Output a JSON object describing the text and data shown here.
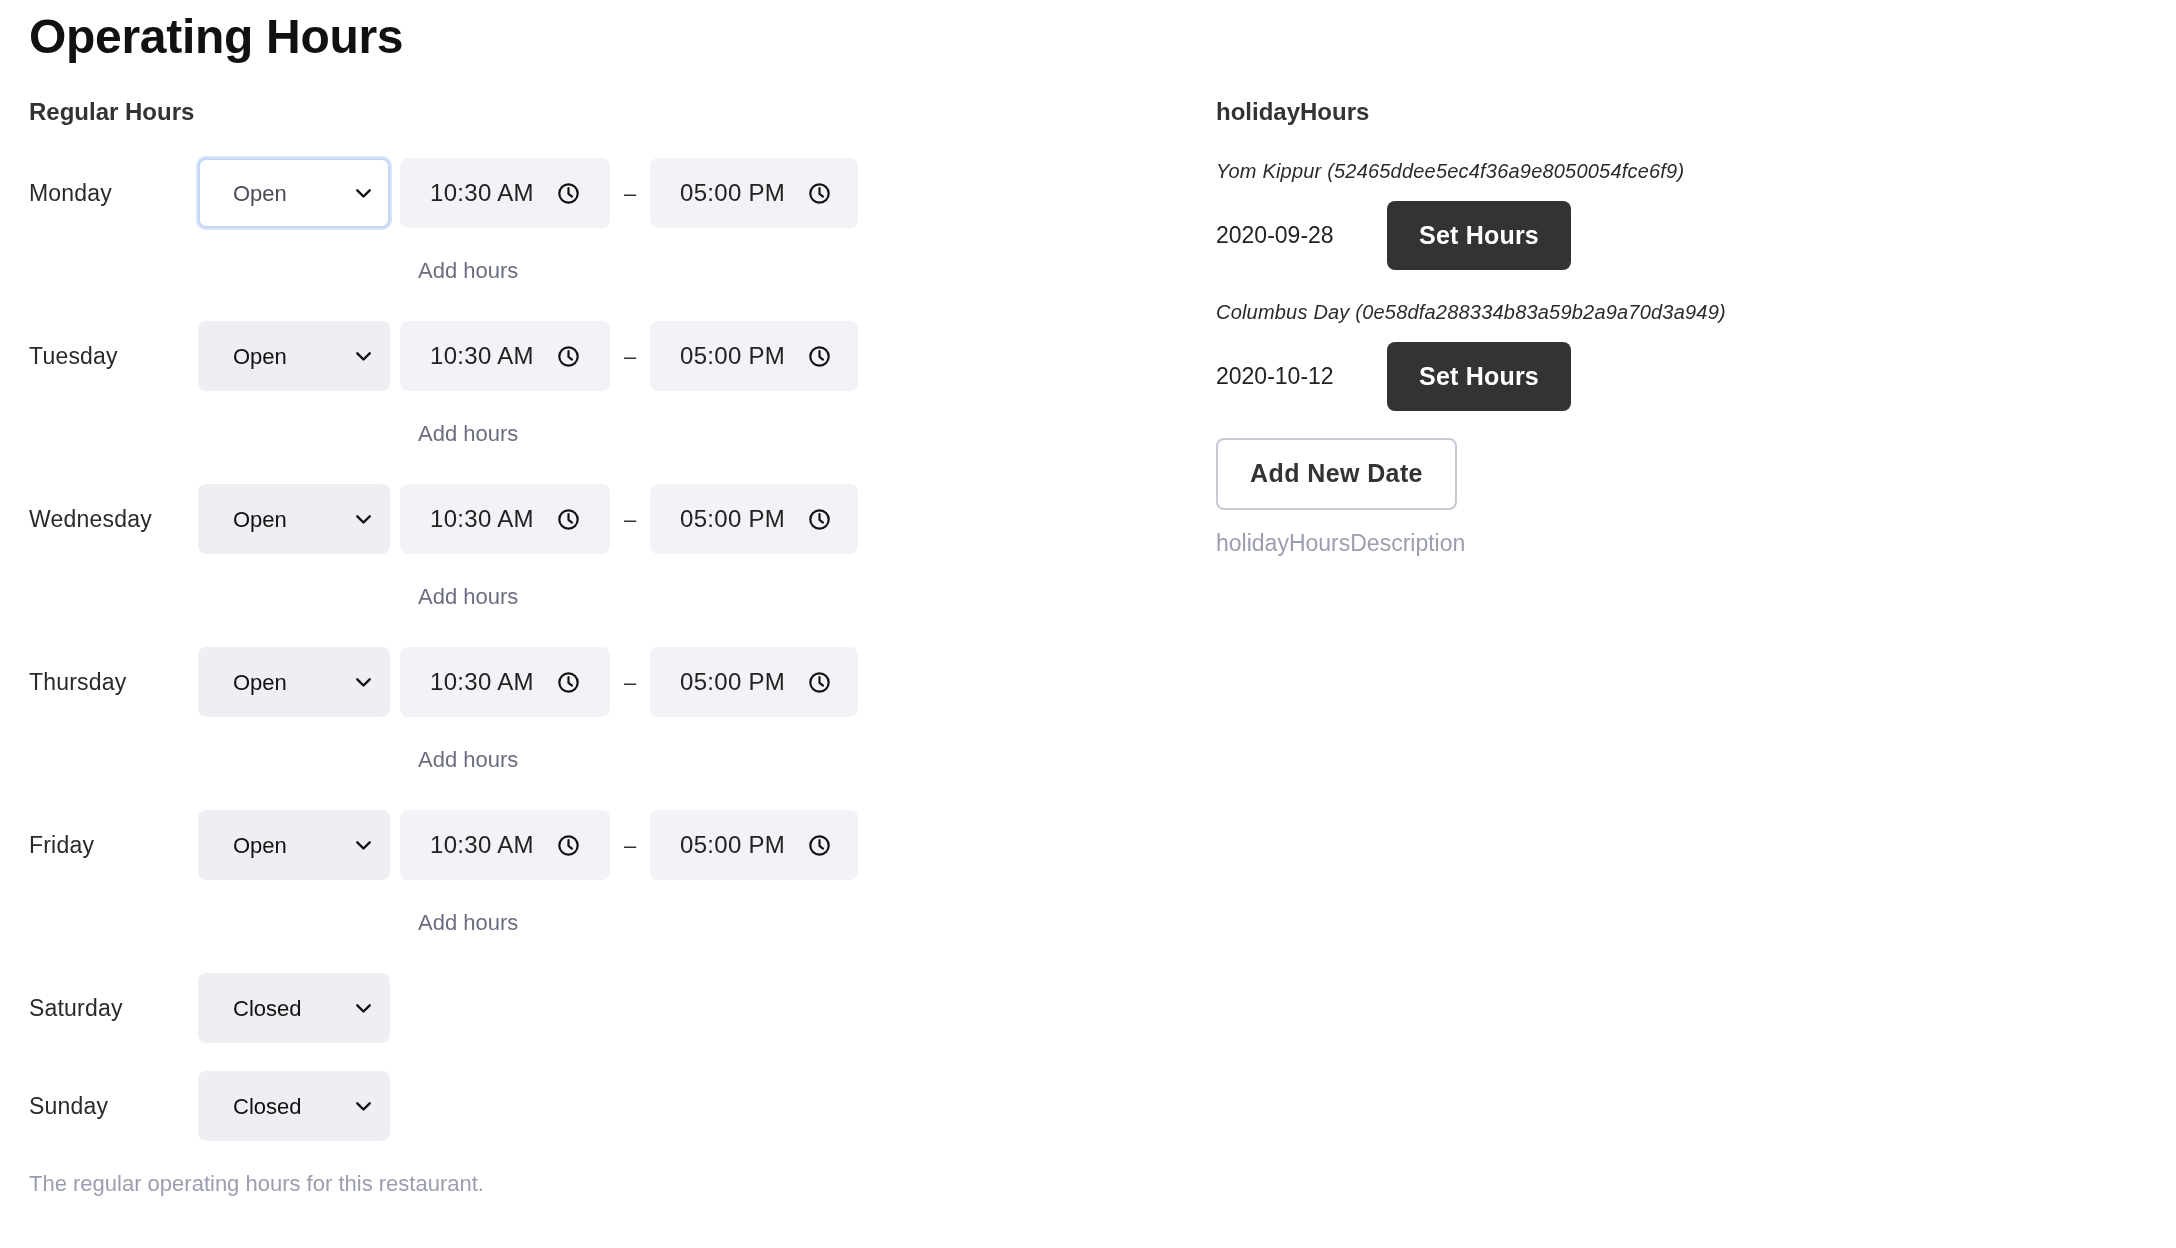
{
  "title": "Operating Hours",
  "regular_hours": {
    "heading": "Regular Hours",
    "days": [
      {
        "day": "Monday",
        "status": {
          "value": "Open",
          "focused": true
        },
        "hours": [
          {
            "start": "10:30 AM",
            "separator": "–",
            "end": "05:00 PM"
          }
        ],
        "add_hours": "Add hours"
      },
      {
        "day": "Tuesday",
        "status": {
          "value": "Open",
          "focused": false
        },
        "hours": [
          {
            "start": "10:30 AM",
            "separator": "–",
            "end": "05:00 PM"
          }
        ],
        "add_hours": "Add hours"
      },
      {
        "day": "Wednesday",
        "status": {
          "value": "Open",
          "focused": false
        },
        "hours": [
          {
            "start": "10:30 AM",
            "separator": "–",
            "end": "05:00 PM"
          }
        ],
        "add_hours": "Add hours"
      },
      {
        "day": "Thursday",
        "status": {
          "value": "Open",
          "focused": false
        },
        "hours": [
          {
            "start": "10:30 AM",
            "separator": "–",
            "end": "05:00 PM"
          }
        ],
        "add_hours": "Add hours"
      },
      {
        "day": "Friday",
        "status": {
          "value": "Open",
          "focused": false
        },
        "hours": [
          {
            "start": "10:30 AM",
            "separator": "–",
            "end": "05:00 PM"
          }
        ],
        "add_hours": "Add hours"
      },
      {
        "day": "Saturday",
        "status": {
          "value": "Closed",
          "focused": false
        }
      },
      {
        "day": "Sunday",
        "status": {
          "value": "Closed",
          "focused": false
        }
      }
    ],
    "description": "The regular operating hours for this restaurant."
  },
  "holiday_hours": {
    "heading": "holidayHours",
    "holidays": [
      {
        "name": "Yom Kippur (52465ddee5ec4f36a9e8050054fce6f9)",
        "date": "2020-09-28",
        "button": "Set Hours"
      },
      {
        "name": "Columbus Day (0e58dfa288334b83a59b2a9a70d3a949)",
        "date": "2020-10-12",
        "button": "Set Hours"
      }
    ],
    "add_button": "Add New Date",
    "description": "holidayHoursDescription"
  }
}
